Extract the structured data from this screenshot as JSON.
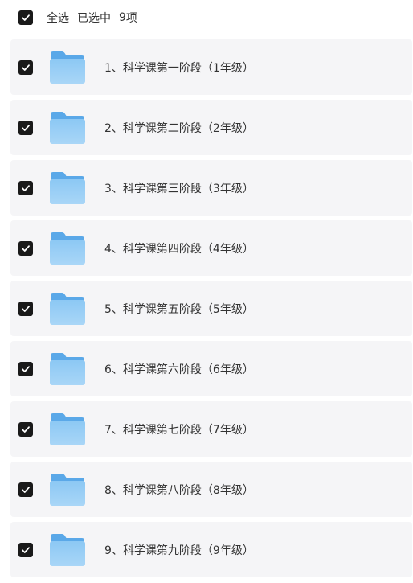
{
  "header": {
    "select_all_label": "全选",
    "selected_prefix": "已选中",
    "selected_count": "9",
    "selected_suffix": "项",
    "checked": true
  },
  "colors": {
    "checkbox": "#1a1a1a",
    "row_bg": "#f5f5f7",
    "folder_light": "#8cc8f4",
    "folder_dark": "#5aa8e8"
  },
  "items": [
    {
      "label": "1、科学课第一阶段（1年级）",
      "icon": "folder-icon",
      "checked": true
    },
    {
      "label": "2、科学课第二阶段（2年级）",
      "icon": "folder-icon",
      "checked": true
    },
    {
      "label": "3、科学课第三阶段（3年级）",
      "icon": "folder-icon",
      "checked": true
    },
    {
      "label": "4、科学课第四阶段（4年级）",
      "icon": "folder-icon",
      "checked": true
    },
    {
      "label": "5、科学课第五阶段（5年级）",
      "icon": "folder-icon",
      "checked": true
    },
    {
      "label": "6、科学课第六阶段（6年级）",
      "icon": "folder-icon",
      "checked": true
    },
    {
      "label": "7、科学课第七阶段（7年级）",
      "icon": "folder-icon",
      "checked": true
    },
    {
      "label": "8、科学课第八阶段（8年级）",
      "icon": "folder-icon",
      "checked": true
    },
    {
      "label": "9、科学课第九阶段（9年级）",
      "icon": "folder-icon",
      "checked": true
    }
  ]
}
